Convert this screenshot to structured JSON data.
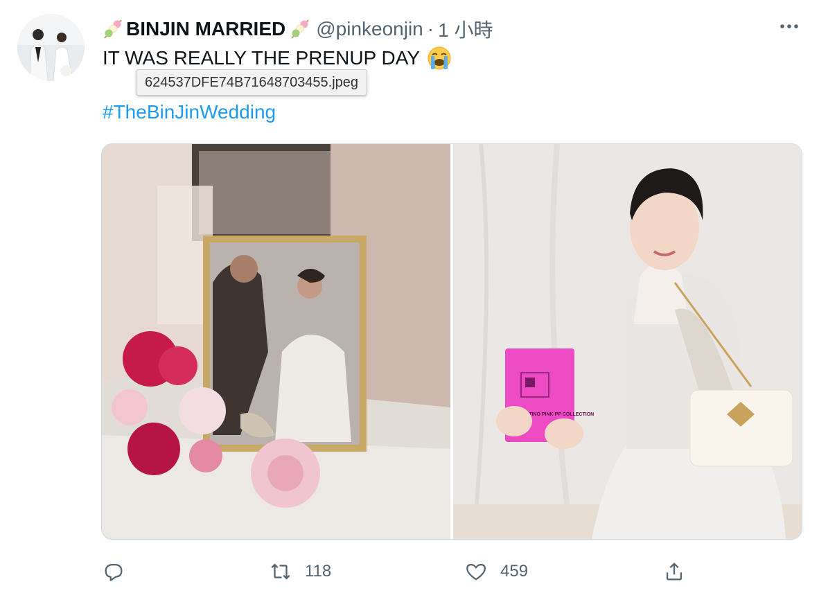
{
  "tweet": {
    "display_name": "BINJIN MARRIED",
    "handle": "@pinkeonjin",
    "separator": "·",
    "time": "1 小時",
    "text": "IT WAS REALLY THE PRENUP DAY",
    "hashtag": "#TheBinJinWedding",
    "tooltip": "624537DFE74B71648703455.jpeg",
    "book_text": "VALENTINO PINK PP COLLECTION"
  },
  "actions": {
    "reply_count": "",
    "retweet_count": "118",
    "like_count": "459"
  },
  "icons": {
    "header_emoji": "dango-icon",
    "text_emoji": "loudly-crying-face-icon",
    "more": "more-dots-icon",
    "reply": "reply-icon",
    "retweet": "retweet-icon",
    "like": "heart-icon",
    "share": "share-icon"
  },
  "colors": {
    "link": "#1d9bf0",
    "secondary": "#536471",
    "text": "#0f1419"
  }
}
